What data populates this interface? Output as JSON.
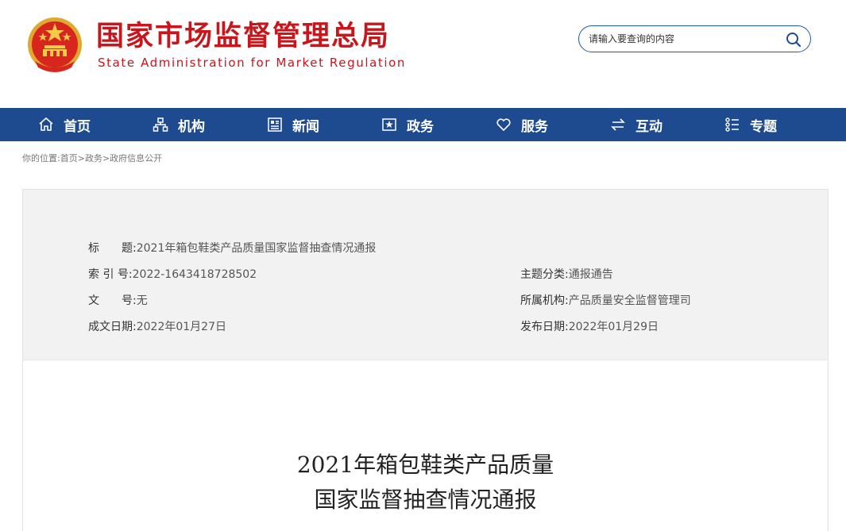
{
  "header": {
    "title_cn": "国家市场监督管理总局",
    "title_en": "State Administration for Market Regulation",
    "brand_color": "#c8161d"
  },
  "search": {
    "placeholder": "请输入要查询的内容"
  },
  "nav": {
    "bg_color": "#1e4a8f",
    "items": [
      {
        "label": "首页",
        "icon": "home-icon"
      },
      {
        "label": "机构",
        "icon": "org-chart-icon"
      },
      {
        "label": "新闻",
        "icon": "newspaper-icon"
      },
      {
        "label": "政务",
        "icon": "government-icon"
      },
      {
        "label": "服务",
        "icon": "heart-icon"
      },
      {
        "label": "互动",
        "icon": "swap-arrows-icon"
      },
      {
        "label": "专题",
        "icon": "topic-list-icon"
      }
    ]
  },
  "breadcrumb": {
    "prefix": "你的位置:",
    "items": [
      "首页",
      "政务",
      "政府信息公开"
    ],
    "separator": ">"
  },
  "meta": {
    "title_label": "标　　题:",
    "title_value": "2021年箱包鞋类产品质量国家监督抽查情况通报",
    "index_label": "索 引 号:",
    "index_value": "2022-1643418728502",
    "category_label": "主题分类:",
    "category_value": "通报通告",
    "doc_no_label": "文　　号:",
    "doc_no_value": "无",
    "org_label": "所属机构:",
    "org_value": "产品质量安全监督管理司",
    "created_label": "成文日期:",
    "created_value": "2022年01月27日",
    "published_label": "发布日期:",
    "published_value": "2022年01月29日"
  },
  "article": {
    "title_line1": "2021年箱包鞋类产品质量",
    "title_line2": "国家监督抽查情况通报"
  }
}
